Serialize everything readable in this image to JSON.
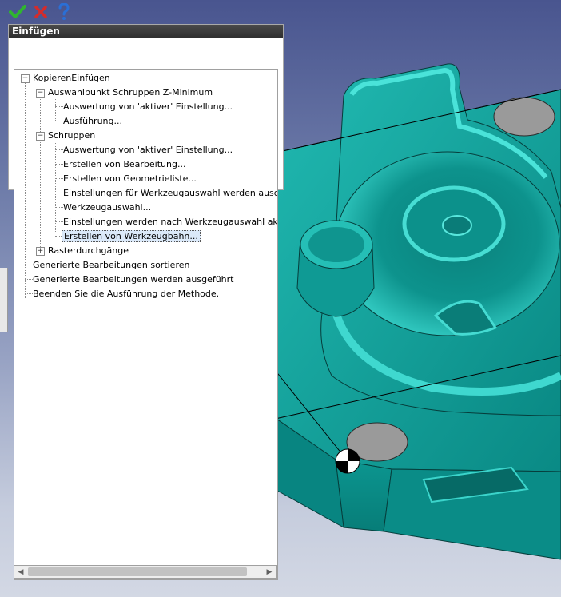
{
  "window": {
    "panel_title": "Einfügen"
  },
  "toolbar": {
    "ok_icon": "checkmark-icon",
    "cancel_icon": "close-icon",
    "help_icon": "help-icon",
    "ok_color": "#2fb52f",
    "cancel_color": "#d52b2b",
    "help_color": "#2a6fd6"
  },
  "tree": {
    "items": [
      {
        "label": "KopierenEinfügen",
        "level": 0,
        "expander": "−"
      },
      {
        "label": "Auswahlpunkt Schruppen Z-Minimum",
        "level": 1,
        "expander": "−"
      },
      {
        "label": "Auswertung von 'aktiver' Einstellung...",
        "level": 2
      },
      {
        "label": "Ausführung...",
        "level": 2
      },
      {
        "label": "Schruppen",
        "level": 1,
        "expander": "−"
      },
      {
        "label": "Auswertung von 'aktiver' Einstellung...",
        "level": 2
      },
      {
        "label": "Erstellen von Bearbeitung...",
        "level": 2
      },
      {
        "label": "Erstellen von Geometrieliste...",
        "level": 2
      },
      {
        "label": "Einstellungen für Werkzeugauswahl werden ausgew",
        "level": 2
      },
      {
        "label": "Werkzeugauswahl...",
        "level": 2
      },
      {
        "label": "Einstellungen werden nach Werkzeugauswahl aktu",
        "level": 2
      },
      {
        "label": "Erstellen von Werkzeugbahn...",
        "level": 2,
        "selected": true
      },
      {
        "label": "Rasterdurchgänge",
        "level": 1,
        "expander": "+"
      },
      {
        "label": "Generierte Bearbeitungen sortieren",
        "level": 0
      },
      {
        "label": "Generierte Bearbeitungen werden ausgeführt",
        "level": 0
      },
      {
        "label": "Beenden Sie die Ausführung der Methode.",
        "level": 0
      }
    ]
  },
  "scrollbar": {
    "left_arrow": "◀",
    "right_arrow": "▶"
  },
  "model": {
    "body_color": "#0e9c96",
    "highlight_color": "#3fd8cf",
    "dark_color": "#066f6b",
    "hole_color": "#9a9a9a"
  }
}
